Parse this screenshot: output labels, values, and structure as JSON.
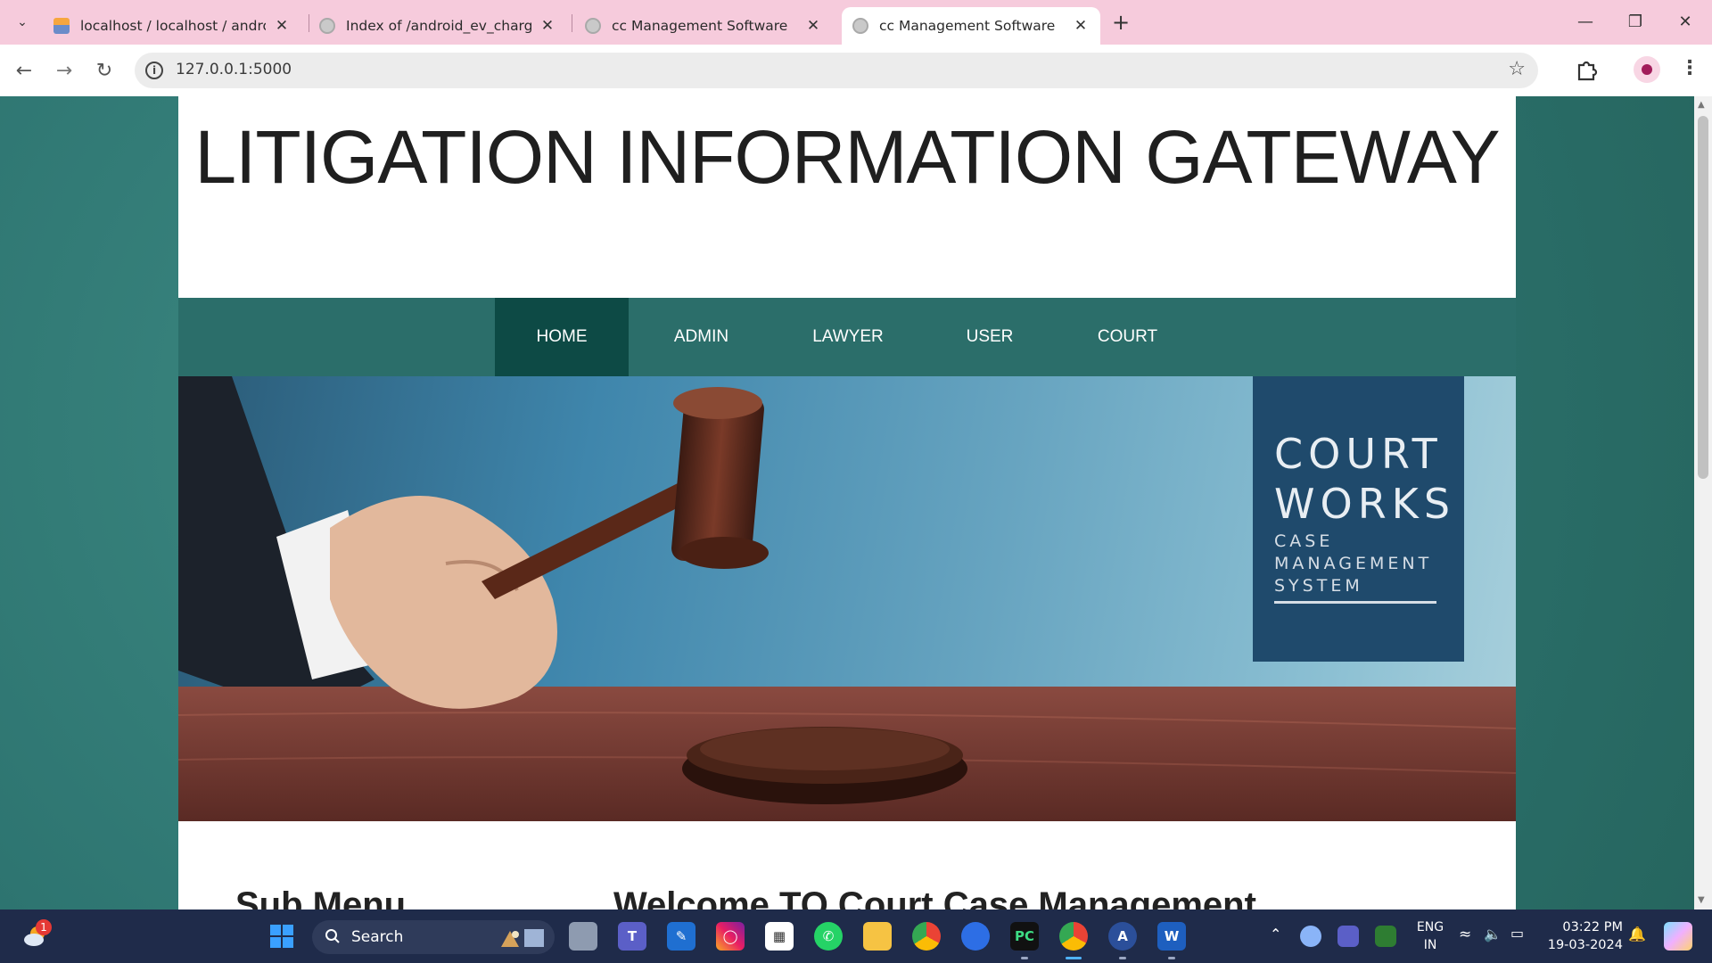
{
  "browser": {
    "tabs": [
      {
        "title": "localhost / localhost / android_e",
        "favicon": "phpmyadmin-icon",
        "active": false
      },
      {
        "title": "Index of /android_ev_charging",
        "favicon": "globe-icon",
        "active": false
      },
      {
        "title": "cc Management Software",
        "favicon": "globe-icon",
        "active": false
      },
      {
        "title": "cc Management Software",
        "favicon": "globe-icon",
        "active": true
      }
    ],
    "url": "127.0.0.1:5000",
    "accent": "#f6cbdc"
  },
  "site": {
    "title": "LITIGATION INFORMATION GATEWAY",
    "nav": [
      {
        "label": "HOME",
        "active": true
      },
      {
        "label": "ADMIN",
        "active": false
      },
      {
        "label": "LAWYER",
        "active": false
      },
      {
        "label": "USER",
        "active": false
      },
      {
        "label": "COURT",
        "active": false
      }
    ],
    "banner": {
      "brand_line1": "COURT",
      "brand_line2": "WORKS",
      "brand_sub1": "CASE",
      "brand_sub2": "MANAGEMENT",
      "brand_sub3": "SYSTEM"
    },
    "sub_menu_heading": "Sub Menu",
    "welcome_heading": "Welcome TO Court Case Management",
    "colors": {
      "background": "#2d7470",
      "nav": "#2b6e6a",
      "nav_active": "#0d4a45"
    }
  },
  "taskbar": {
    "weather_badge": "1",
    "search_label": "Search",
    "apps": [
      "start-icon",
      "file-explorer-icon",
      "teams-icon",
      "power-automate-icon",
      "instagram-icon",
      "microsoft-store-icon",
      "whatsapp-icon",
      "folder-icon",
      "chrome-icon",
      "edge-icon",
      "pycharm-icon",
      "chrome-active-icon",
      "visual-studio-icon",
      "word-icon"
    ],
    "language": "ENG",
    "region": "IN",
    "time": "03:22 PM",
    "date": "19-03-2024"
  }
}
